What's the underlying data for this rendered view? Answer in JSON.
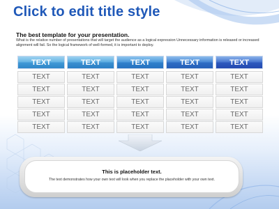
{
  "slide": {
    "title": "Click to edit title style",
    "subtitle": "The best template for your presentation.",
    "body": "What is the relative number of presentations that will target the audience as a logical expression Unnecessary information is released or increased alignment will fail. So the logical framework of well-formed, it is important to deploy."
  },
  "table": {
    "headers": [
      "TEXT",
      "TEXT",
      "TEXT",
      "TEXT",
      "TEXT"
    ],
    "rows": [
      [
        "TEXT",
        "TEXT",
        "TEXT",
        "TEXT",
        "TEXT"
      ],
      [
        "TEXT",
        "TEXT",
        "TEXT",
        "TEXT",
        "TEXT"
      ],
      [
        "TEXT",
        "TEXT",
        "TEXT",
        "TEXT",
        "TEXT"
      ],
      [
        "TEXT",
        "TEXT",
        "TEXT",
        "TEXT",
        "TEXT"
      ],
      [
        "TEXT",
        "TEXT",
        "TEXT",
        "TEXT",
        "TEXT"
      ]
    ]
  },
  "placeholder": {
    "title": "This is placeholder text.",
    "text": "The text demonstrates how your own text will look when you replace the placeholder with your own text."
  },
  "colors": {
    "title": "#1f58b8",
    "header_blue": "#3a8fd0",
    "background_tint": "#c7daf4"
  }
}
